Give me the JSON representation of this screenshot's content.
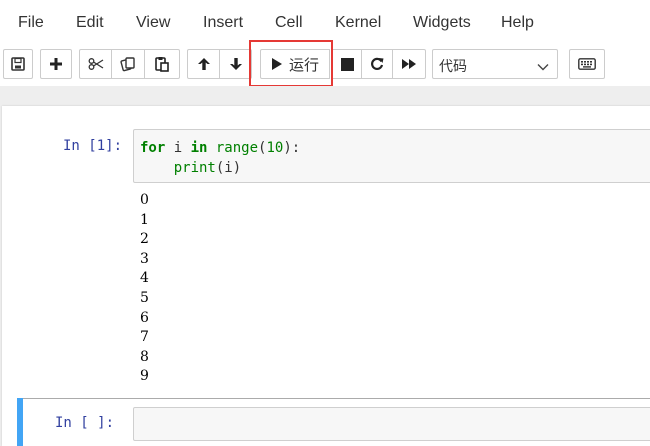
{
  "menubar": {
    "items": [
      "File",
      "Edit",
      "View",
      "Insert",
      "Cell",
      "Kernel",
      "Widgets",
      "Help"
    ]
  },
  "toolbar": {
    "buttons": [
      {
        "name": "save-icon"
      },
      {
        "name": "plus-icon"
      },
      {
        "name": "scissors-icon"
      },
      {
        "name": "copy-icon"
      },
      {
        "name": "paste-icon"
      },
      {
        "name": "arrow-up-icon"
      },
      {
        "name": "arrow-down-icon"
      },
      {
        "name": "play-icon"
      },
      {
        "name": "stop-icon"
      },
      {
        "name": "restart-icon"
      },
      {
        "name": "fast-forward-icon"
      },
      {
        "name": "keyboard-icon"
      }
    ],
    "run_label": "运行",
    "cell_type_selected": "代码"
  },
  "cells": [
    {
      "prompt": "In  [1]:",
      "code_line1_kw1": "for",
      "code_line1_var": " i ",
      "code_line1_kw2": "in",
      "code_line1_fn": " range",
      "code_line1_open": "(",
      "code_line1_num": "10",
      "code_line1_close": "):",
      "code_line2_indent": "    ",
      "code_line2_fn": "print",
      "code_line2_rest": "(i)",
      "output": [
        "0",
        "1",
        "2",
        "3",
        "4",
        "5",
        "6",
        "7",
        "8",
        "9"
      ]
    },
    {
      "prompt": "In  [ ]:"
    }
  ],
  "colors": {
    "highlight": "#e53935",
    "selected_cell_bar": "#42a5f5",
    "prompt": "#303f9f",
    "keyword": "#008000"
  }
}
